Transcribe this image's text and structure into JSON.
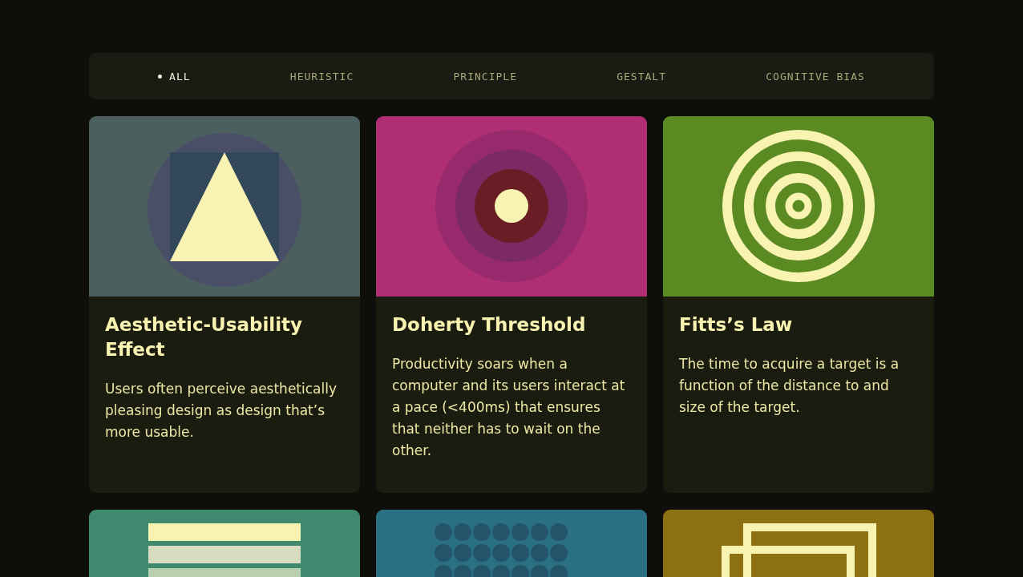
{
  "filters": [
    {
      "label": "ALL",
      "selected": true
    },
    {
      "label": "HEURISTIC",
      "selected": false
    },
    {
      "label": "PRINCIPLE",
      "selected": false
    },
    {
      "label": "GESTALT",
      "selected": false
    },
    {
      "label": "COGNITIVE BIAS",
      "selected": false
    }
  ],
  "cards": [
    {
      "art": {
        "kind": "triangle",
        "color": "#4c5f5f"
      },
      "title": "Aesthetic-Usability Effect",
      "description": "Users often perceive aesthetically pleasing design as design that’s more usable."
    },
    {
      "art": {
        "kind": "target",
        "color": "#b02f74"
      },
      "title": "Doherty Threshold",
      "description": "Productivity soars when a computer and its users interact at a pace (<400ms) that ensures that neither has to wait on the other."
    },
    {
      "art": {
        "kind": "rings",
        "color": "#5b8a22"
      },
      "title": "Fitts’s Law",
      "description": "The time to acquire a target is a function of the distance to and size of the target."
    },
    {
      "art": {
        "kind": "stripes",
        "color": "#3f8a6e"
      }
    },
    {
      "art": {
        "kind": "dots",
        "color": "#2a6f82"
      }
    },
    {
      "art": {
        "kind": "squares",
        "color": "#8c7012"
      }
    }
  ]
}
